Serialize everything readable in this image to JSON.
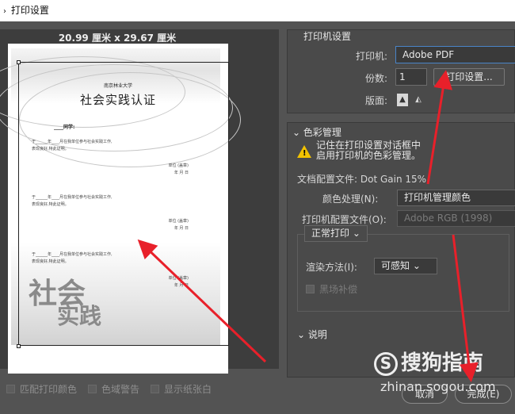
{
  "window": {
    "title": "打印设置"
  },
  "preview": {
    "dimensions": "20.99 厘米 x 29.67 厘米",
    "certificate": {
      "school": "南京林业大学",
      "title": "社会实践认证",
      "student_label": "同学:",
      "body_line1": "于______年____月在我单位参与社会实践工作,",
      "body_line2": "表现良好,特此证明。",
      "sign_unit": "单位 (盖章)",
      "sign_date": "年  月  日",
      "big_text_1": "社会",
      "big_text_2": "实践"
    }
  },
  "bottom_options": [
    {
      "label": "匹配打印颜色"
    },
    {
      "label": "色域警告"
    },
    {
      "label": "显示纸张白"
    }
  ],
  "printer_settings": {
    "section_title": "打印机设置",
    "printer_label": "打印机:",
    "printer_value": "Adobe PDF",
    "copies_label": "份数:",
    "copies_value": "1",
    "print_settings_button": "打印设置...",
    "layout_label": "版面:"
  },
  "color_management": {
    "section_title": "色彩管理",
    "warning_line1": "记住在打印设置对话框中",
    "warning_line2": "启用打印机的色彩管理。",
    "doc_profile": "文档配置文件: Dot Gain 15%",
    "color_handling_label": "颜色处理(N):",
    "color_handling_value": "打印机管理颜色",
    "printer_profile_label": "打印机配置文件(O):",
    "printer_profile_value": "Adobe RGB (1998)",
    "print_mode": "正常打印",
    "render_label": "渲染方法(I):",
    "render_value": "可感知",
    "black_point": "黑场补偿"
  },
  "description": {
    "section_title": "说明"
  },
  "footer": {
    "cancel": "取消",
    "done": "完成(E)"
  },
  "watermark": {
    "brand": "搜狗指南",
    "url": "zhinan.sogou.com",
    "logo_letter": "S"
  },
  "colors": {
    "arrow": "#e8202a",
    "accent_border": "#4a84c8",
    "warning": "#f2c200"
  }
}
